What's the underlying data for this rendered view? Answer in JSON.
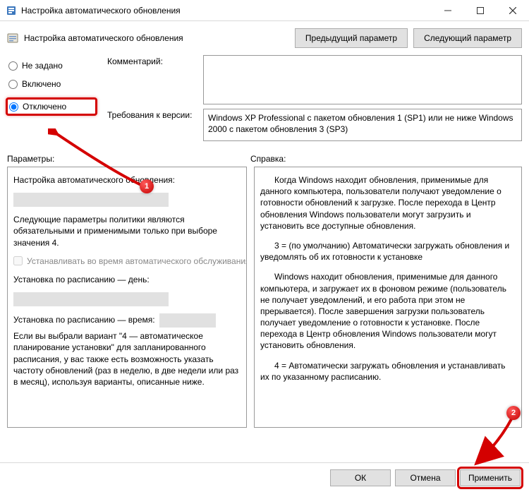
{
  "window": {
    "title": "Настройка автоматического обновления"
  },
  "header": {
    "policy_title": "Настройка автоматического обновления",
    "prev_btn": "Предыдущий параметр",
    "next_btn": "Следующий параметр"
  },
  "radios": {
    "not_configured": "Не задано",
    "enabled": "Включено",
    "disabled": "Отключено",
    "selected": "disabled"
  },
  "labels": {
    "comment": "Комментарий:",
    "version_req": "Требования к версии:",
    "params": "Параметры:",
    "help": "Справка:"
  },
  "version_text": "Windows XP Professional с пакетом обновления 1 (SP1) или не ниже Windows 2000 с пакетом обновления 3 (SP3)",
  "comment_value": "",
  "params_panel": {
    "title": "Настройка автоматического обновления:",
    "desc": "Следующие параметры политики являются обязательными и применимыми только при выборе значения 4.",
    "checkbox_label": "Устанавливать во время автоматического обслуживания",
    "sched_day_label": "Установка по расписанию — день:",
    "sched_time_label": "Установка по расписанию — время:",
    "footer": "Если вы выбрали вариант \"4 — автоматическое планирование установки\" для запланированного расписания, у вас также есть возможность указать частоту обновлений (раз в неделю, в две недели или раз в месяц), используя варианты, описанные ниже."
  },
  "help_panel": {
    "p1": "Когда Windows находит обновления, применимые для данного компьютера, пользователи получают уведомление о готовности обновлений к загрузке. После перехода в Центр обновления Windows пользователи могут загрузить и установить все доступные обновления.",
    "p2": "3 = (по умолчанию) Автоматически загружать обновления и уведомлять об их готовности к установке",
    "p3": "Windows находит обновления, применимые для данного компьютера, и загружает их в фоновом режиме (пользователь не получает уведомлений, и его работа при этом не прерывается). После завершения загрузки пользователь получает уведомление о готовности к установке. После перехода в Центр обновления Windows пользователи могут установить обновления.",
    "p4": "4 = Автоматически загружать обновления и устанавливать их по указанному расписанию."
  },
  "buttons": {
    "ok": "ОК",
    "cancel": "Отмена",
    "apply": "Применить"
  },
  "annotations": {
    "badge1": "1",
    "badge2": "2"
  }
}
